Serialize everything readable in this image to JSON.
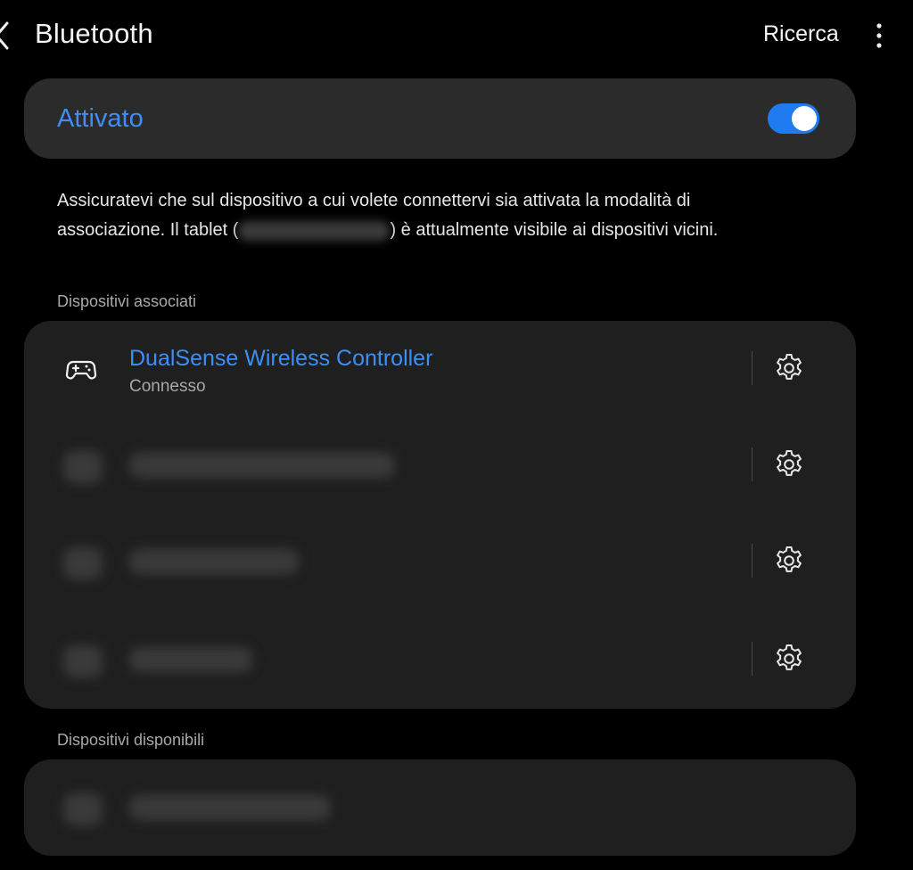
{
  "header": {
    "title": "Bluetooth",
    "search_label": "Ricerca"
  },
  "toggle": {
    "label": "Attivato",
    "state": "on",
    "accent_color": "#1f7cf0"
  },
  "description": {
    "part1": "Assicuratevi che sul dispositivo a cui volete connettervi sia attivata la modalità di associazione. Il tablet (",
    "part2": ") è attualmente visibile ai dispositivi vicini."
  },
  "paired": {
    "header": "Dispositivi associati",
    "devices": [
      {
        "name": "DualSense Wireless Controller",
        "status": "Connesso",
        "icon": "gamepad-icon"
      },
      {
        "name": "",
        "status": "",
        "icon": "redacted"
      },
      {
        "name": "",
        "status": "",
        "icon": "redacted"
      },
      {
        "name": "",
        "status": "",
        "icon": "redacted"
      }
    ]
  },
  "available": {
    "header": "Dispositivi disponibili",
    "devices": [
      {
        "name": "",
        "icon": "redacted"
      }
    ]
  },
  "icons": {
    "back": "chevron-left-icon",
    "more": "more-vertical-icon",
    "settings": "gear-icon"
  },
  "colors": {
    "background": "#000000",
    "card": "#2b2b2b",
    "list_card": "#1f1f1f",
    "accent_text": "#3d8ef7"
  }
}
